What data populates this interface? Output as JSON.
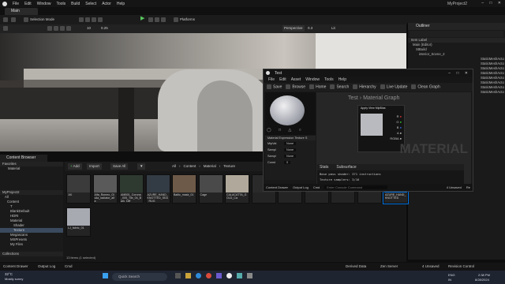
{
  "app": {
    "project_title": "MyProject2",
    "main_tab": "Main",
    "menu": [
      "File",
      "Edit",
      "Window",
      "Tools",
      "Build",
      "Select",
      "Actor",
      "Help"
    ]
  },
  "toolbar": {
    "mode": "Selection Mode",
    "platforms": "Platforms"
  },
  "viewport": {
    "perspective": "Perspective",
    "lit": "Lit",
    "speed": "0.3",
    "fov": "10",
    "scale": "0.25"
  },
  "outliner": {
    "title": "Outliner",
    "column": "Item Label",
    "rows": [
      "Main (Editor)",
      "StBuild",
      "interior_Scene_2",
      "StaticMeshActo",
      "StaticMeshActo",
      "StaticMeshActo",
      "StaticMeshActo",
      "StaticMeshActo",
      "StaticMeshActo",
      "StaticMeshActo",
      "StaticMeshActo"
    ]
  },
  "material_editor": {
    "window_title": "Test",
    "menu": [
      "File",
      "Edit",
      "Asset",
      "Window",
      "Tools",
      "Help"
    ],
    "save": "Save",
    "browse": "Browse",
    "hierarchy": "Hierarchy",
    "live_update": "Live Update",
    "clean_graph": "Clean Graph",
    "home": "Home",
    "search": "Search",
    "graph_title": "Test",
    "graph_subtitle": "Material Graph",
    "node_title": "Apply View MipBias",
    "pins": [
      "R",
      "G",
      "B",
      "A",
      "RGBA"
    ],
    "watermark": "MATERIAL",
    "details_header": "Material Expression Texture S",
    "details_rows": [
      {
        "label": "MipVal",
        "value": "None"
      },
      {
        "label": "Sampl",
        "value": "None"
      },
      {
        "label": "Sampl",
        "value": "None"
      },
      {
        "label": "Const",
        "value": "0"
      }
    ],
    "stats_tab": "Stats",
    "subsurface": "Subsurface",
    "stats_line": "Base pass shader: 371 instructions",
    "stats_line2": "Texture samplers: 3/16",
    "cb_drawer": "Content Drawer",
    "output_log": "Output Log",
    "cmd": "Cmd",
    "console_placeholder": "Enter Console Command",
    "unsaved": "4 Unsaved",
    "revision": "Re"
  },
  "content_browser": {
    "tab": "Content Browser",
    "add": "Add",
    "import": "Import",
    "save_all": "Save All",
    "path": [
      "All",
      "Content",
      "Material",
      "Texture"
    ],
    "search_placeholder": "Search Texture",
    "favorites": "Favorites",
    "favorite_item": "Material",
    "project": "MyProject2",
    "tree": [
      "All",
      "Content",
      "T",
      "BlankDefault",
      "HDRI",
      "Material",
      "Shader",
      "Texture",
      "Megascans",
      "MSPresets",
      "My Files"
    ],
    "collections": "Collections",
    "item_count": "13 items (1 selected)",
    "assets": [
      {
        "name": "1KI",
        "color": "#3b3b3b"
      },
      {
        "name": "Alfa_Romeo_Giulia_radiator_alfa",
        "color": "#5a5a5a"
      },
      {
        "name": "AMB01_Corona_005_Tile_04_Bark_Diff",
        "color": "#2e3a30"
      },
      {
        "name": "AZURE_HAND_KNOTTED_SEA_RUG",
        "color": "#333b44"
      },
      {
        "name": "Baltic_mask_01",
        "color": "#6e5a48"
      },
      {
        "name": "Cage",
        "color": "#4a4a4a"
      },
      {
        "name": "CALACATTA_GOLD_Ca",
        "color": "#b0a89a"
      },
      {
        "name": "",
        "color": "#2a2a2a"
      },
      {
        "name": "",
        "color": "#2a2a2a"
      },
      {
        "name": "",
        "color": "#2a2a2a"
      },
      {
        "name": "",
        "color": "#2a2a2a"
      },
      {
        "name": "",
        "color": "#2a2a2a"
      },
      {
        "name": "AZURE_HAND_KNOTTED",
        "color": "#2a2a2a"
      },
      {
        "name": "LJ_fabric_01",
        "color": "#a8aab2"
      }
    ]
  },
  "status": {
    "content_drawer": "Content Drawer",
    "output_log": "Output Log",
    "cmd": "Cmd",
    "unsaved": "4 Unsaved",
    "revision": "Revision Control",
    "derived": "Derived Data",
    "zen": "Zen Server"
  },
  "taskbar": {
    "weather_temp": "32°C",
    "weather_desc": "Mostly sunny",
    "search": "Quick Search",
    "lang": "ENG",
    "region": "IN",
    "time": "2:38 PM",
    "date": "8/28/2024"
  },
  "colors": {
    "accent_blue": "#0070e0",
    "play_green": "#58c95c",
    "folder_yellow": "#c9a23a"
  }
}
